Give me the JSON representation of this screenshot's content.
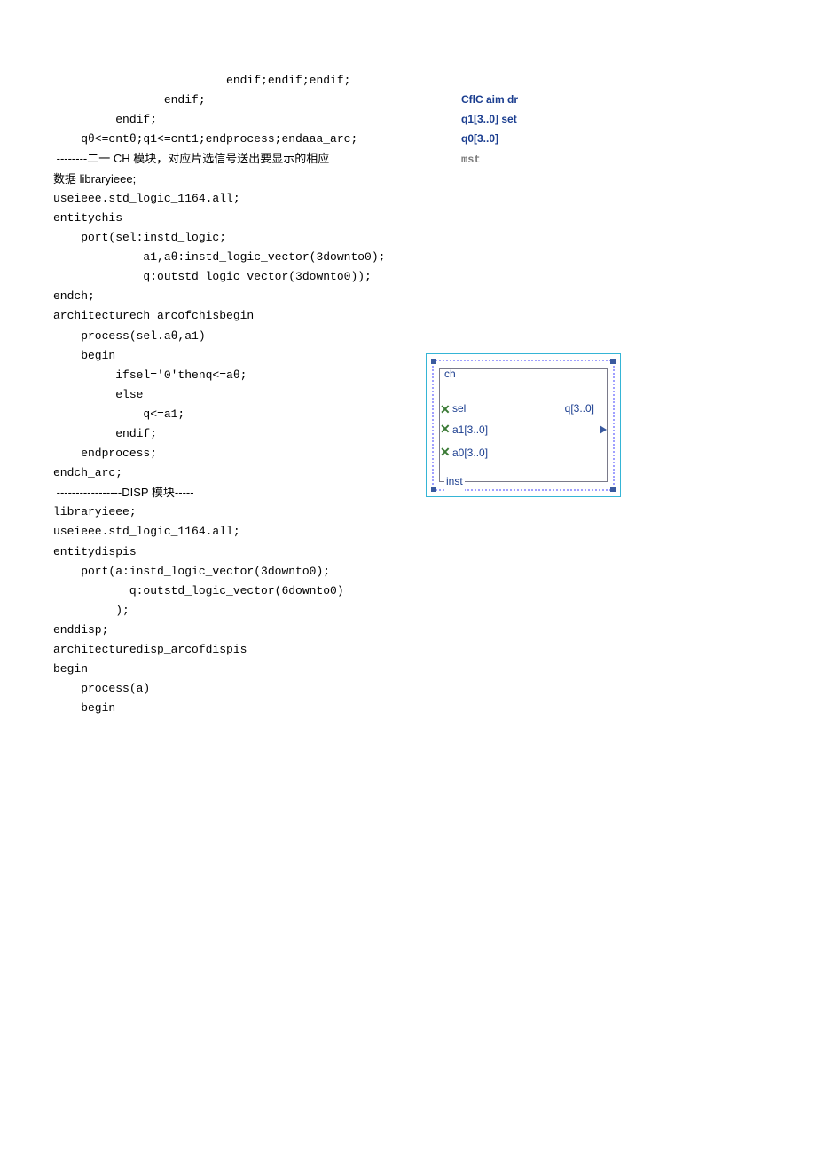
{
  "lines": {
    "l1": "                         endif;endif;endif;",
    "l2": "                endif;",
    "l3": "         endif;",
    "l4": "    qθ<=cntθ;q1<=cnt1;endprocess;endaaa_arc;",
    "l5": " --------二一 CH 模块，对应片选信号送出要显示的相应",
    "l6": "数据 libraryieee;",
    "l7": "useieee.std_logic_1164.all;",
    "l8": "",
    "l9": "entitychis",
    "l10": "    port(sel:instd_logic;",
    "l11": "             a1,aθ:instd_logic_vector(3downto0);",
    "l12": "             q:outstd_logic_vector(3downto0));",
    "l13": "endch;",
    "l14": "",
    "l15": "architecturech_arcofchisbegin",
    "l16": "    process(sel.aθ,a1)",
    "l17": "    begin",
    "l18": "         ifsel='0'thenq<=aθ;",
    "l19": "         else",
    "l20": "             q<=a1;",
    "l21": "         endif;",
    "l22": "    endprocess;",
    "l23": "endch_arc;",
    "l24": " -----------------DISP 模块-----",
    "l25": "libraryieee;",
    "l26": "useieee.std_logic_1164.all;",
    "l27": "",
    "l28": "entitydispis",
    "l29": "    port(a:instd_logic_vector(3downto0);",
    "l30": "           q:outstd_logic_vector(6downto0)",
    "l31": "         );",
    "l32": "enddisp;",
    "l33": "architecturedisp_arcofdispis",
    "l34": "begin",
    "l35": "    process(a)",
    "l36": "    begin"
  },
  "side": {
    "s1": "CflC aim dr",
    "s2": "q1[3..0] set",
    "s3": "q0[3..0]",
    "s4": "mst"
  },
  "diagram": {
    "title": "ch",
    "inst": "inst",
    "ports_in": [
      "sel",
      "a1[3..0]",
      "a0[3..0]"
    ],
    "port_out": "q[3..0]"
  }
}
